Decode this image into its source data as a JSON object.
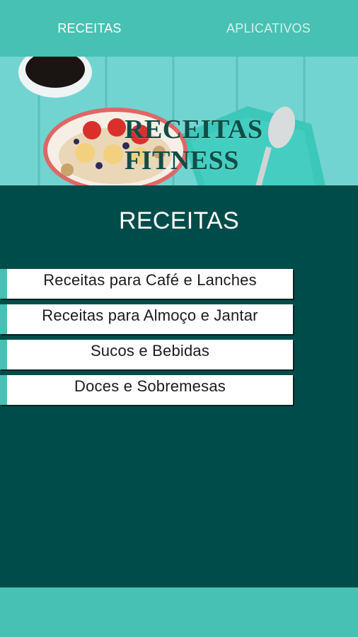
{
  "tabs": {
    "receitas_label": "RECEITAS",
    "aplicativos_label": "APLICATIVOS"
  },
  "banner": {
    "title": "RECEITAS FITNESS"
  },
  "section": {
    "title": "RECEITAS"
  },
  "menu": [
    "Receitas para Café e Lanches",
    "Receitas para Almoço e Jantar",
    "Sucos e Bebidas",
    "Doces e Sobremesas"
  ],
  "colors": {
    "primary_teal": "#47c1b2",
    "dark_teal_bg": "#004c4a",
    "card_white": "#ffffff",
    "banner_title": "#0f4e46"
  }
}
